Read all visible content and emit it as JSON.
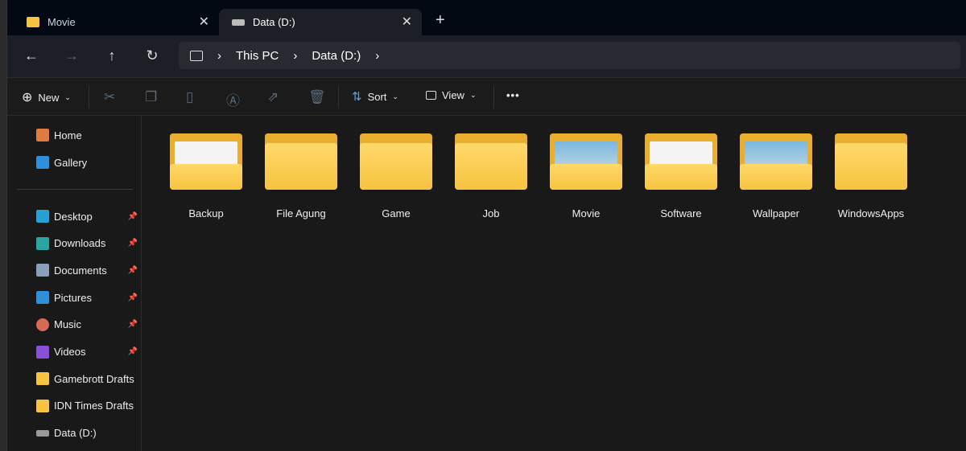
{
  "tabs": [
    {
      "label": "Movie",
      "icon": "folder-icon"
    },
    {
      "label": "Data (D:)",
      "icon": "drive-icon",
      "active": true
    }
  ],
  "breadcrumb": [
    "This PC",
    "Data (D:)"
  ],
  "toolbar": {
    "new": "New",
    "sort": "Sort",
    "view": "View"
  },
  "sidebar": {
    "top": [
      {
        "label": "Home",
        "color": "#e07a3e"
      },
      {
        "label": "Gallery",
        "color": "#2f8fd8"
      }
    ],
    "items": [
      {
        "label": "Desktop",
        "color": "#27a0d8",
        "pinned": true
      },
      {
        "label": "Downloads",
        "color": "#2aa6a0",
        "pinned": true
      },
      {
        "label": "Documents",
        "color": "#8aa0b8",
        "pinned": true
      },
      {
        "label": "Pictures",
        "color": "#2f8fd8",
        "pinned": true
      },
      {
        "label": "Music",
        "color": "#d86a55",
        "pinned": true
      },
      {
        "label": "Videos",
        "color": "#8a4fd8",
        "pinned": true
      },
      {
        "label": "Gamebrott Drafts",
        "color": "#f7c340",
        "pinned": false
      },
      {
        "label": "IDN Times Drafts",
        "color": "#f7c340",
        "pinned": false
      },
      {
        "label": "Data (D:)",
        "color": "#9a9a9a",
        "pinned": false
      }
    ]
  },
  "folders": [
    {
      "name": "Backup",
      "preview": "doc"
    },
    {
      "name": "File Agung",
      "preview": "none"
    },
    {
      "name": "Game",
      "preview": "none"
    },
    {
      "name": "Job",
      "preview": "none"
    },
    {
      "name": "Movie",
      "preview": "image"
    },
    {
      "name": "Software",
      "preview": "doc"
    },
    {
      "name": "Wallpaper",
      "preview": "image"
    },
    {
      "name": "WindowsApps",
      "preview": "none"
    }
  ]
}
